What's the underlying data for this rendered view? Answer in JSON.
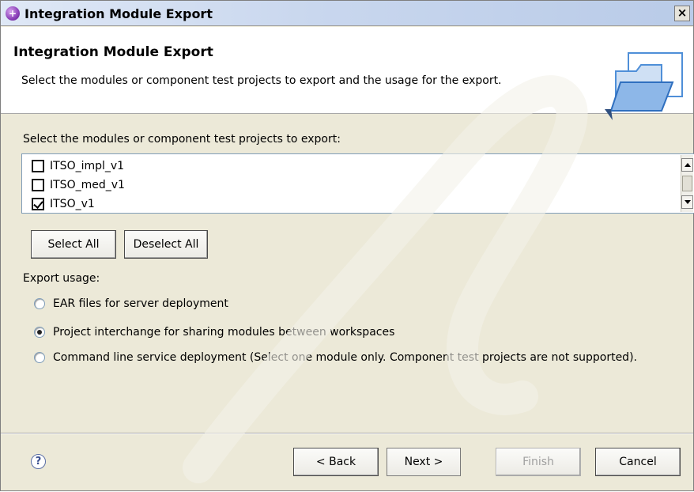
{
  "window": {
    "title": "Integration Module Export",
    "close_glyph": "×"
  },
  "header": {
    "title": "Integration Module Export",
    "description": "Select the modules or component test projects to export and the usage for the export."
  },
  "modules": {
    "label": "Select the modules or component test projects to export:",
    "items": [
      {
        "label": "ITSO_impl_v1",
        "checked": false
      },
      {
        "label": "ITSO_med_v1",
        "checked": false
      },
      {
        "label": "ITSO_v1",
        "checked": true
      }
    ]
  },
  "selection_buttons": {
    "select_all": "Select All",
    "deselect_all": "Deselect All"
  },
  "usage": {
    "label": "Export usage:",
    "options": [
      {
        "label": "EAR files for server deployment",
        "selected": false
      },
      {
        "label": "Project interchange for sharing modules between workspaces",
        "selected": true
      },
      {
        "label": "Command line service deployment (Select one module only. Component test projects are not supported).",
        "selected": false
      }
    ]
  },
  "footer": {
    "help_glyph": "?",
    "back": "< Back",
    "next": "Next >",
    "finish": "Finish",
    "cancel": "Cancel"
  },
  "colors": {
    "title_icon": "#8a3fb8",
    "dialog_bg": "#ece9d8",
    "folder_blue": "#4f8fd8"
  }
}
